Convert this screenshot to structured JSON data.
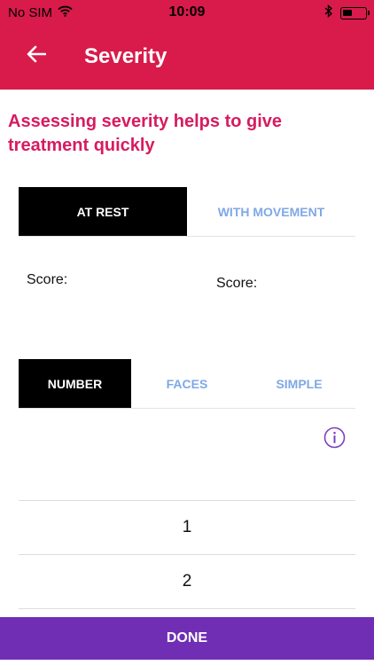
{
  "status_bar": {
    "carrier": "No SIM",
    "time": "10:09",
    "icons": [
      "wifi-icon",
      "bluetooth-icon",
      "battery-icon"
    ]
  },
  "header": {
    "title": "Severity",
    "back_icon": "arrow-left-icon",
    "background": "#d81b4a"
  },
  "headline": "Assessing severity helps to give treatment quickly",
  "condition_tabs": [
    {
      "label": "AT REST",
      "active": true
    },
    {
      "label": "WITH MOVEMENT",
      "active": false
    }
  ],
  "scores": {
    "left_label": "Score:",
    "right_label": "Score:"
  },
  "scale_tabs": [
    {
      "label": "NUMBER",
      "active": true
    },
    {
      "label": "FACES",
      "active": false
    },
    {
      "label": "SIMPLE",
      "active": false
    }
  ],
  "info_icon": "info-icon",
  "number_list": [
    "1",
    "2"
  ],
  "done_label": "DONE",
  "colors": {
    "accent_pink": "#d81b60",
    "done_purple": "#6f2eb4",
    "inactive_tab": "#7fa8e6"
  }
}
